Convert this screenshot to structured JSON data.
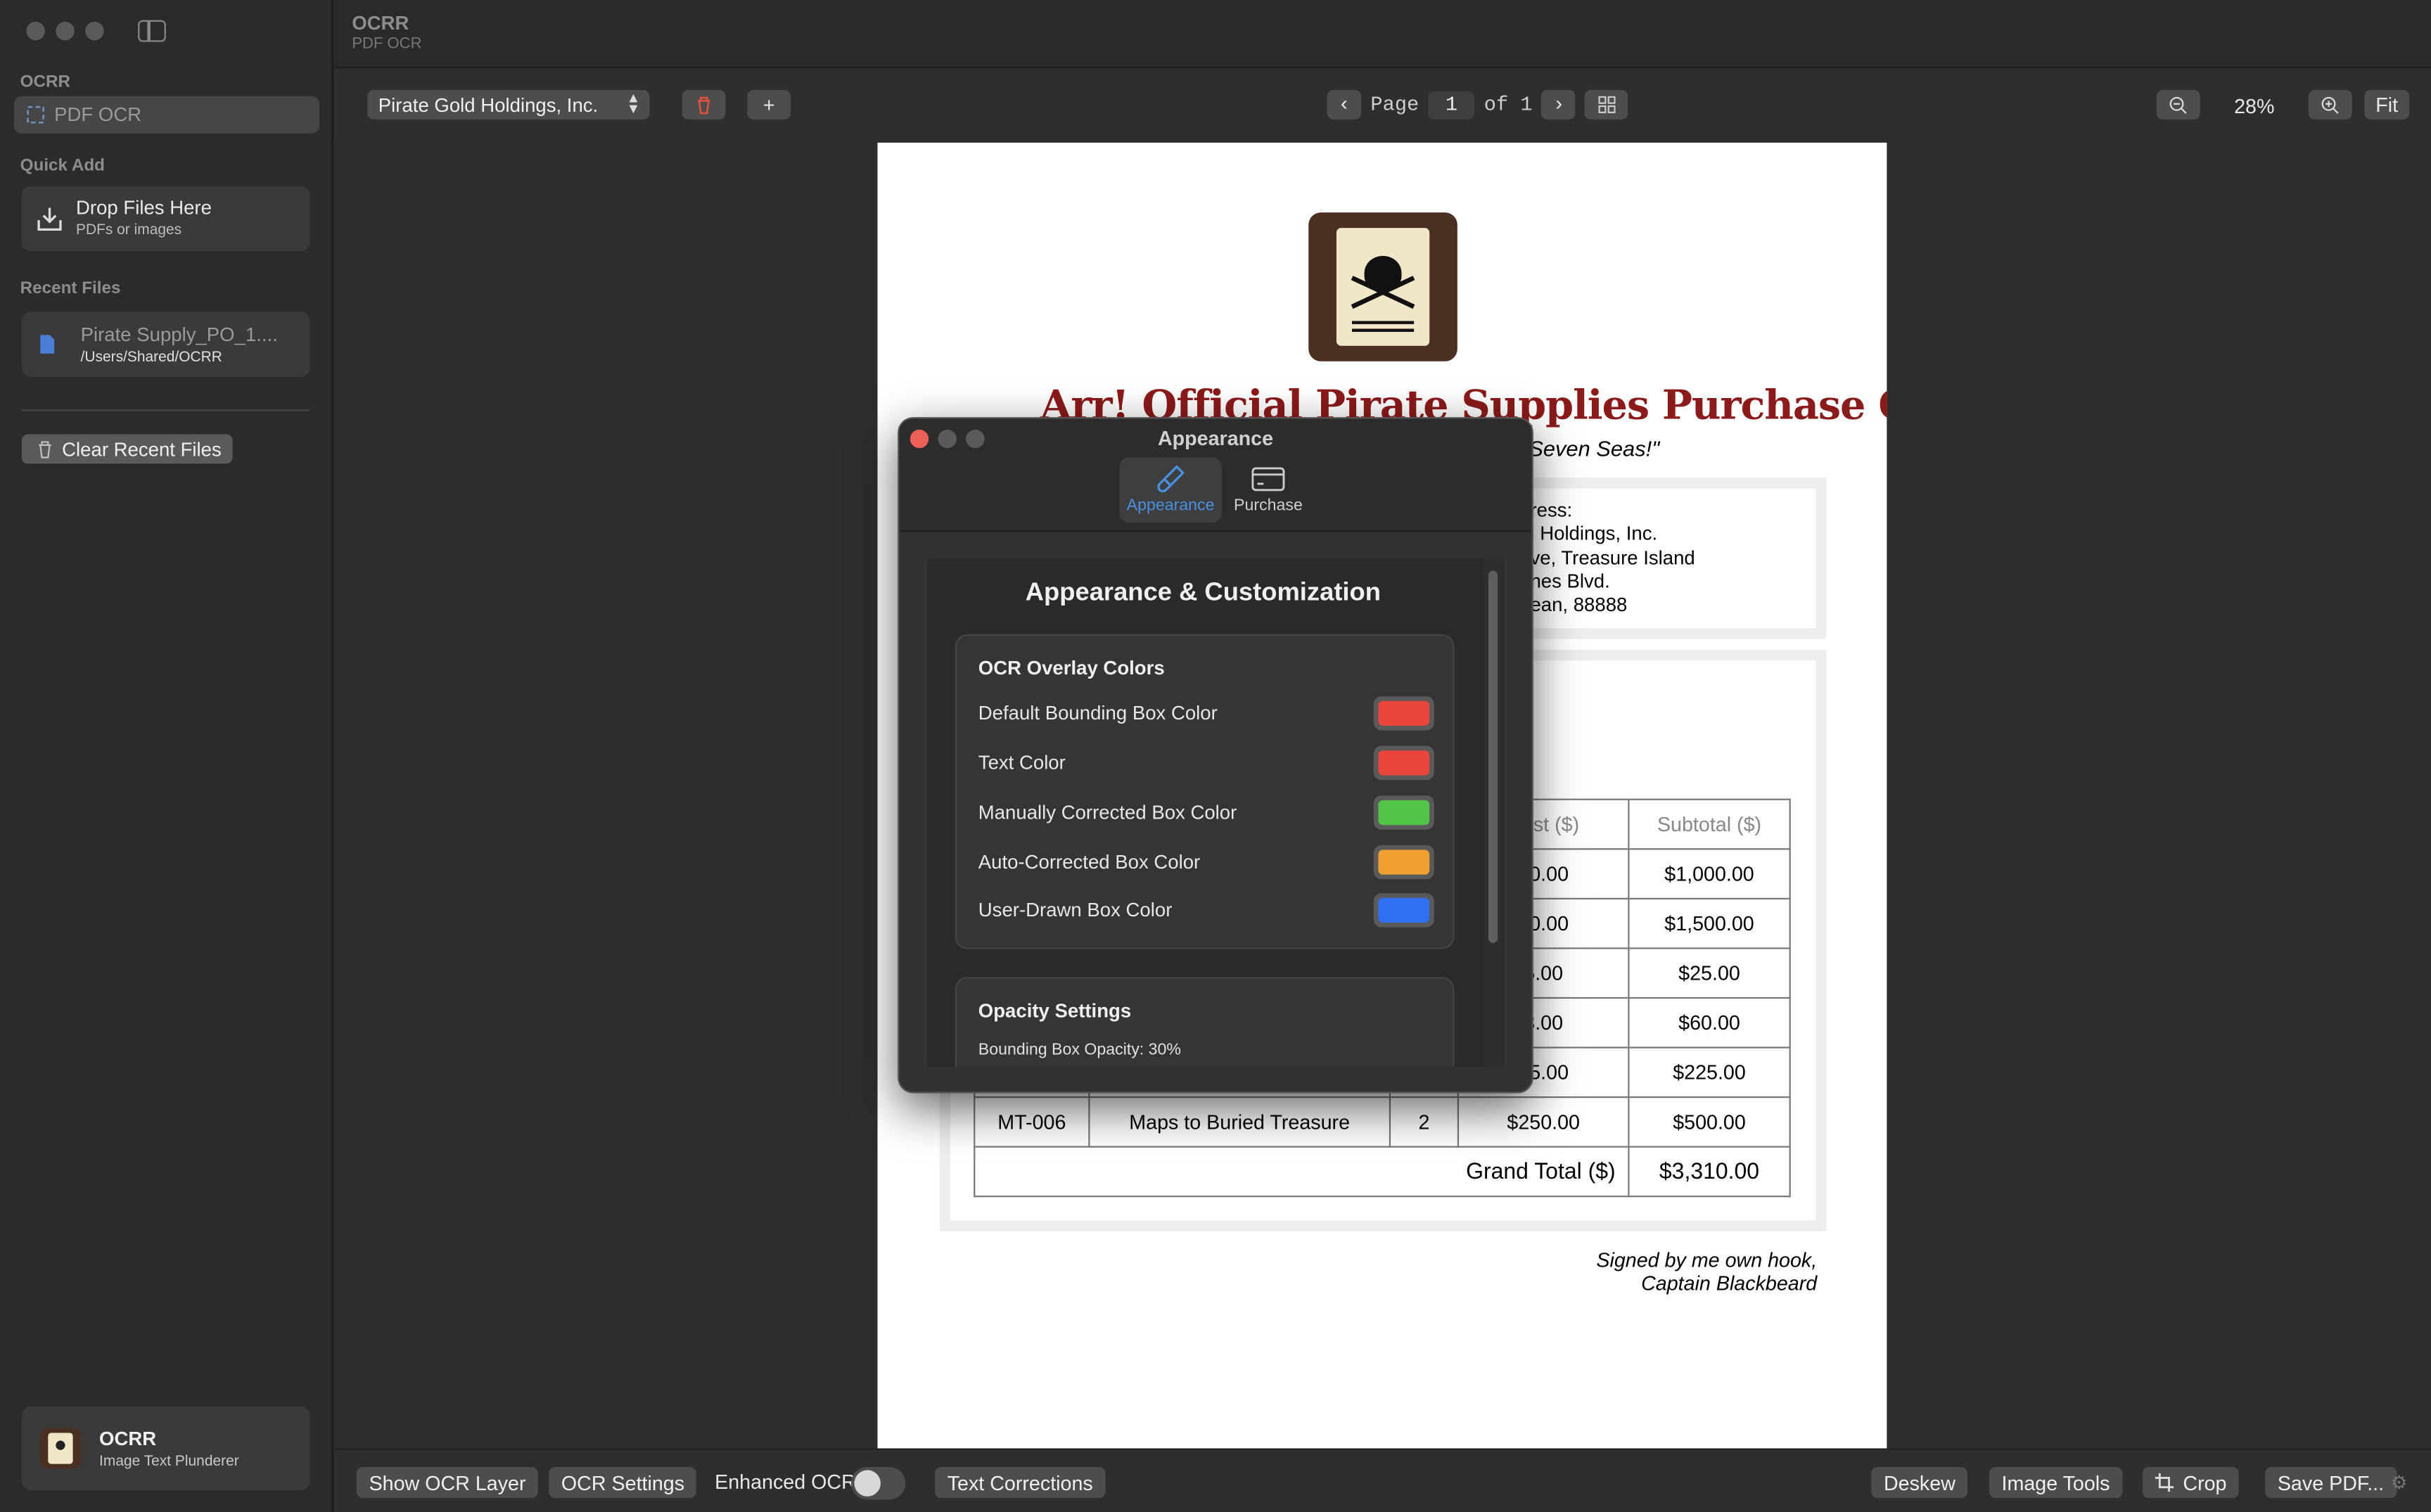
{
  "sidebar": {
    "section_ocr": "OCRR",
    "pdf_item": "PDF OCR",
    "section_quick_add": "Quick Add",
    "drop": {
      "title": "Drop Files Here",
      "subtitle": "PDFs or images"
    },
    "section_recent": "Recent Files",
    "recent_file": {
      "name": "Pirate Supply_PO_1....",
      "path": "/Users/Shared/OCRR"
    },
    "clear_label": "Clear Recent Files",
    "app_card": {
      "name": "OCRR",
      "tagline": "Image Text Plunderer"
    }
  },
  "titlebar": {
    "title": "OCRR",
    "subtitle": "PDF OCR"
  },
  "toolbar": {
    "document_select": "Pirate Gold Holdings, Inc.",
    "page_label": "Page",
    "page_value": "1",
    "of_label": "of 1",
    "zoom": "28%",
    "fit_label": "Fit"
  },
  "document": {
    "title": "Arr! Official Pirate Supplies Purchase Order",
    "subtitle": "Seven Seas!\"",
    "address_lines": [
      "ress:",
      "l Holdings, Inc.",
      "ve, Treasure Island",
      "nes Blvd.",
      "ean, 88888"
    ],
    "table_headers": [
      "Cost ($)",
      "Subtotal ($)"
    ],
    "rows": [
      [
        "",
        "",
        "",
        "20.00",
        "$1,000.00"
      ],
      [
        "",
        "",
        "",
        "50.00",
        "$1,500.00"
      ],
      [
        "",
        "",
        "",
        "5.00",
        "$25.00"
      ],
      [
        "",
        "",
        "",
        "3.00",
        "$60.00"
      ],
      [
        "",
        "",
        "",
        "75.00",
        "$225.00"
      ],
      [
        "MT-006",
        "Maps to Buried Treasure",
        "2",
        "$250.00",
        "$500.00"
      ]
    ],
    "grand_total_label": "Grand Total ($)",
    "grand_total_value": "$3,310.00",
    "signature": [
      "Signed by me own hook,",
      "Captain Blackbeard"
    ]
  },
  "dialog": {
    "window_title": "Appearance",
    "tabs": [
      {
        "label": "Appearance",
        "icon": "paintbrush-icon"
      },
      {
        "label": "Purchase",
        "icon": "credit-card-icon"
      }
    ],
    "heading": "Appearance & Customization",
    "colors_group": {
      "title": "OCR Overlay Colors",
      "rows": [
        {
          "label": "Default Bounding Box Color",
          "color": "#e8463a"
        },
        {
          "label": "Text Color",
          "color": "#e8463a"
        },
        {
          "label": "Manually Corrected Box Color",
          "color": "#52c447"
        },
        {
          "label": "Auto-Corrected Box Color",
          "color": "#f0a030"
        },
        {
          "label": "User-Drawn Box Color",
          "color": "#2f6ff0"
        }
      ]
    },
    "opacity_group": {
      "title": "Opacity Settings",
      "bbox_opacity": "Bounding Box Opacity: 30%"
    }
  },
  "bottombar": {
    "show_ocr_layer": "Show OCR Layer",
    "ocr_settings": "OCR Settings",
    "enhanced_ocr": "Enhanced OCR",
    "text_corrections": "Text Corrections",
    "deskew": "Deskew",
    "image_tools": "Image Tools",
    "crop": "Crop",
    "save_pdf": "Save PDF..."
  }
}
